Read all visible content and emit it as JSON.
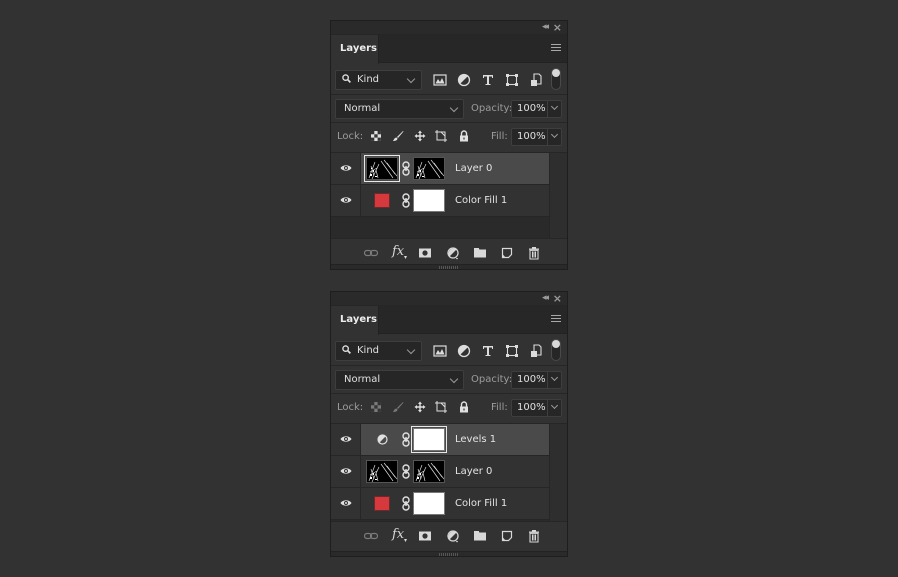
{
  "panels": [
    {
      "tab_label": "Layers",
      "filter": {
        "kind_label": "Kind",
        "icons": [
          "pixel-layer-filter-icon",
          "adjustment-layer-filter-icon",
          "type-layer-filter-icon",
          "shape-layer-filter-icon",
          "smart-object-filter-icon"
        ]
      },
      "blend_mode": "Normal",
      "opacity_label": "Opacity:",
      "opacity_value": "100%",
      "lock_label": "Lock:",
      "fill_label": "Fill:",
      "fill_value": "100%",
      "lock_transparent_enabled": true,
      "lock_paint_enabled": true,
      "layers": [
        {
          "name": "Layer 0",
          "type": "pixel-with-mask",
          "visible": true,
          "selected": true
        },
        {
          "name": "Color Fill 1",
          "type": "color-fill",
          "visible": true,
          "selected": false,
          "color": "#d6393d"
        }
      ]
    },
    {
      "tab_label": "Layers",
      "filter": {
        "kind_label": "Kind",
        "icons": [
          "pixel-layer-filter-icon",
          "adjustment-layer-filter-icon",
          "type-layer-filter-icon",
          "shape-layer-filter-icon",
          "smart-object-filter-icon"
        ]
      },
      "blend_mode": "Normal",
      "opacity_label": "Opacity:",
      "opacity_value": "100%",
      "lock_label": "Lock:",
      "fill_label": "Fill:",
      "fill_value": "100%",
      "lock_transparent_enabled": false,
      "lock_paint_enabled": false,
      "layers": [
        {
          "name": "Levels 1",
          "type": "adjustment",
          "visible": true,
          "selected": true
        },
        {
          "name": "Layer 0",
          "type": "pixel-with-mask",
          "visible": true,
          "selected": false
        },
        {
          "name": "Color Fill 1",
          "type": "color-fill",
          "visible": true,
          "selected": false,
          "color": "#d6393d"
        }
      ]
    }
  ],
  "footer_icons": [
    "link-layers-icon",
    "fx-icon",
    "add-mask-icon",
    "new-adjustment-icon",
    "new-group-icon",
    "new-layer-icon",
    "delete-layer-icon"
  ],
  "colors": {
    "background": "#323232",
    "selected_row": "#4a4a4a",
    "fill_swatch": "#d6393d"
  }
}
